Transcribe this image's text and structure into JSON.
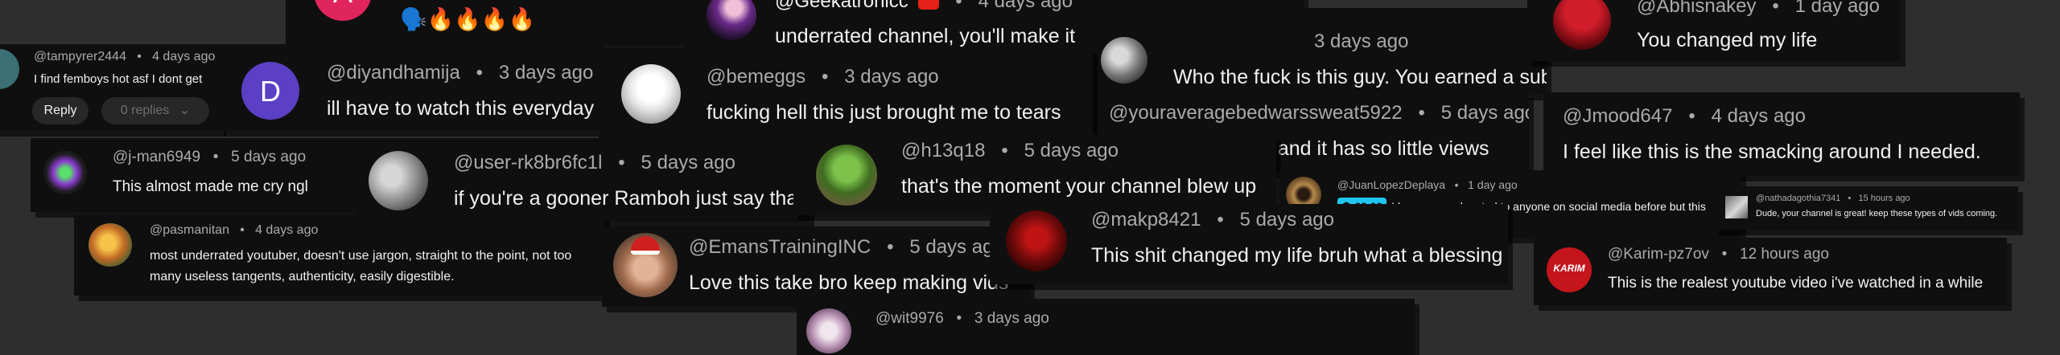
{
  "comments": {
    "c1": {
      "avatar_letter": "A",
      "emojis": "🗣️🔥🔥🔥🔥"
    },
    "c2": {
      "handle": "@Geekatronicc",
      "time": "4 days ago",
      "text": "underrated channel, you'll make it soon man I see it in you"
    },
    "c3": {
      "time": "3 days ago",
      "text": "Who the fuck is this guy. You earned a sub."
    },
    "c4": {
      "handle": "@Abhisnakey",
      "time": "1 day ago",
      "text": "You changed my life"
    },
    "c5": {
      "handle": "@tampyrer2444",
      "time": "4 days ago",
      "text": "I find femboys hot asf I dont get",
      "reply_label": "Reply",
      "replies_label": "0 replies"
    },
    "c6": {
      "avatar_letter": "D",
      "handle": "@diyandhamija",
      "time": "3 days ago",
      "text": "ill have to watch this everyday"
    },
    "c7": {
      "handle": "@bemeggs",
      "time": "3 days ago",
      "text": "fucking hell this just brought me to tears"
    },
    "c8": {
      "handle": "@youraveragebedwarssweat5922",
      "time": "5 days ago",
      "text": "what a good video and it has so little views"
    },
    "c9": {
      "handle": "@Jmood647",
      "time": "4 days ago",
      "text": "I feel like this is the smacking around I needed."
    },
    "c10": {
      "handle": "@j-man6949",
      "time": "5 days ago",
      "text": "This almost made me cry ngl"
    },
    "c11": {
      "handle": "@user-rk8br6fc1l",
      "time": "5 days ago",
      "text": "if you're a gooner Ramboh just say that"
    },
    "c12": {
      "handle": "@h13q18",
      "time": "5 days ago",
      "text": "that's the moment your channel blew up"
    },
    "c13": {
      "handle": "@JuanLopezDeplaya",
      "time": "1 day ago",
      "donation": "€2.00",
      "text": "I have never donated to anyone on social media before but this video was so great I had to"
    },
    "c14": {
      "handle": "@nathadagothia7341",
      "time": "15 hours ago",
      "text": "Dude, your channel is great! keep these types of vids coming."
    },
    "c15": {
      "handle": "@pasmanitan",
      "time": "4 days ago",
      "text": "most underrated youtuber, doesn't use jargon, straight to the point, not too many useless tangents, authenticity, easily digestible."
    },
    "c16": {
      "handle": "@EmansTrainingINC",
      "time": "5 days ago",
      "text": "Love this take bro keep making vids"
    },
    "c17": {
      "handle": "@makp8421",
      "time": "5 days ago",
      "text": "This shit changed my life bruh what a blessing"
    },
    "c18": {
      "handle": "@Karim-pz7ov",
      "time": "12 hours ago",
      "avatar_text": "KARIM",
      "text": "This is the realest youtube video i've watched in a while"
    },
    "c19": {
      "handle": "@wit9976",
      "time": "3 days ago"
    }
  },
  "colors": {
    "background": "#2e2e2e",
    "card": "#0f0f0f",
    "secondary_text": "#aaaaaa",
    "donation_chip": "#1fc6ef",
    "avatar_a": "#e0245e",
    "avatar_d": "#5b3fc4",
    "avatar_karim": "#c4151c"
  }
}
